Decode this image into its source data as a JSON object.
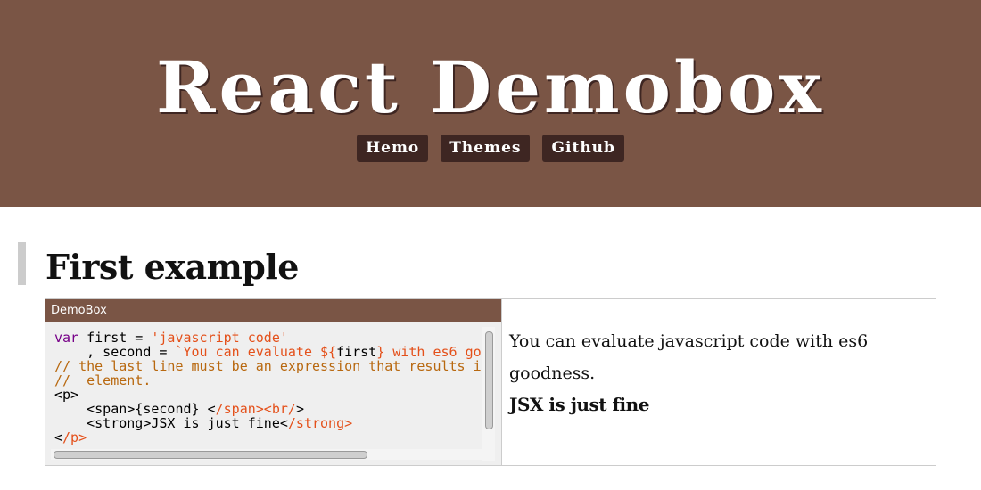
{
  "header": {
    "title": "React Demobox",
    "nav": [
      {
        "label": "Hemo"
      },
      {
        "label": "Themes"
      },
      {
        "label": "Github"
      }
    ]
  },
  "section": {
    "title": "First example"
  },
  "demo": {
    "editor_title": "DemoBox",
    "output": {
      "text": "You can evaluate javascript code with es6 goodness.",
      "strong": "JSX is just fine"
    }
  },
  "colors": {
    "header_bg": "#7a5545",
    "nav_button_bg": "#3e2622",
    "keyword": "#770088",
    "string": "#e4501a",
    "comment": "#b8680f"
  }
}
